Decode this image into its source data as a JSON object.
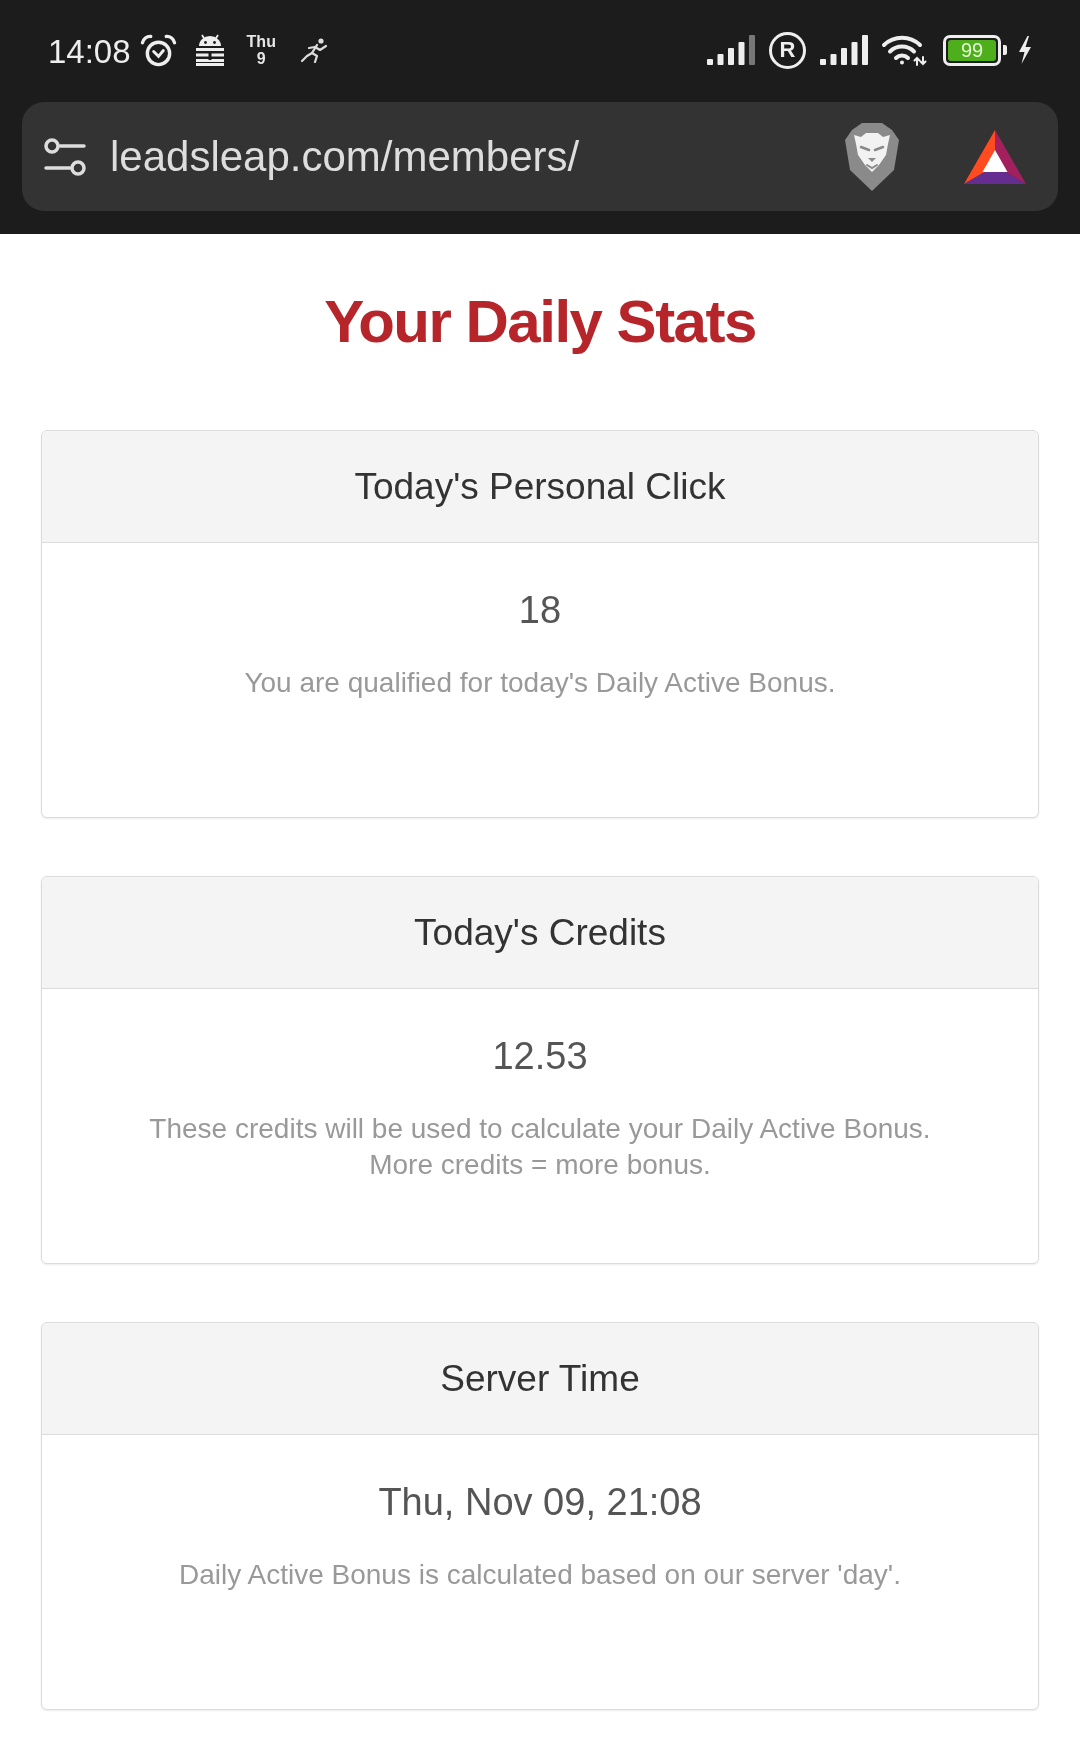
{
  "status_bar": {
    "time": "14:08",
    "calendar": {
      "weekday": "Thu",
      "day": "9"
    },
    "roaming": "R",
    "battery": "99"
  },
  "address_bar": {
    "url": "leadsleap.com/members/"
  },
  "page_title": "Your Daily Stats",
  "cards": [
    {
      "title": "Today's Personal Click",
      "value": "18",
      "note": "You are qualified for today's Daily Active Bonus."
    },
    {
      "title": "Today's Credits",
      "value": "12.53",
      "note": "These credits will be used to calculate your Daily Active Bonus.\nMore credits = more bonus."
    },
    {
      "title": "Server Time",
      "value": "Thu, Nov 09, 21:08",
      "note": "Daily Active Bonus is calculated based on our server 'day'."
    }
  ]
}
